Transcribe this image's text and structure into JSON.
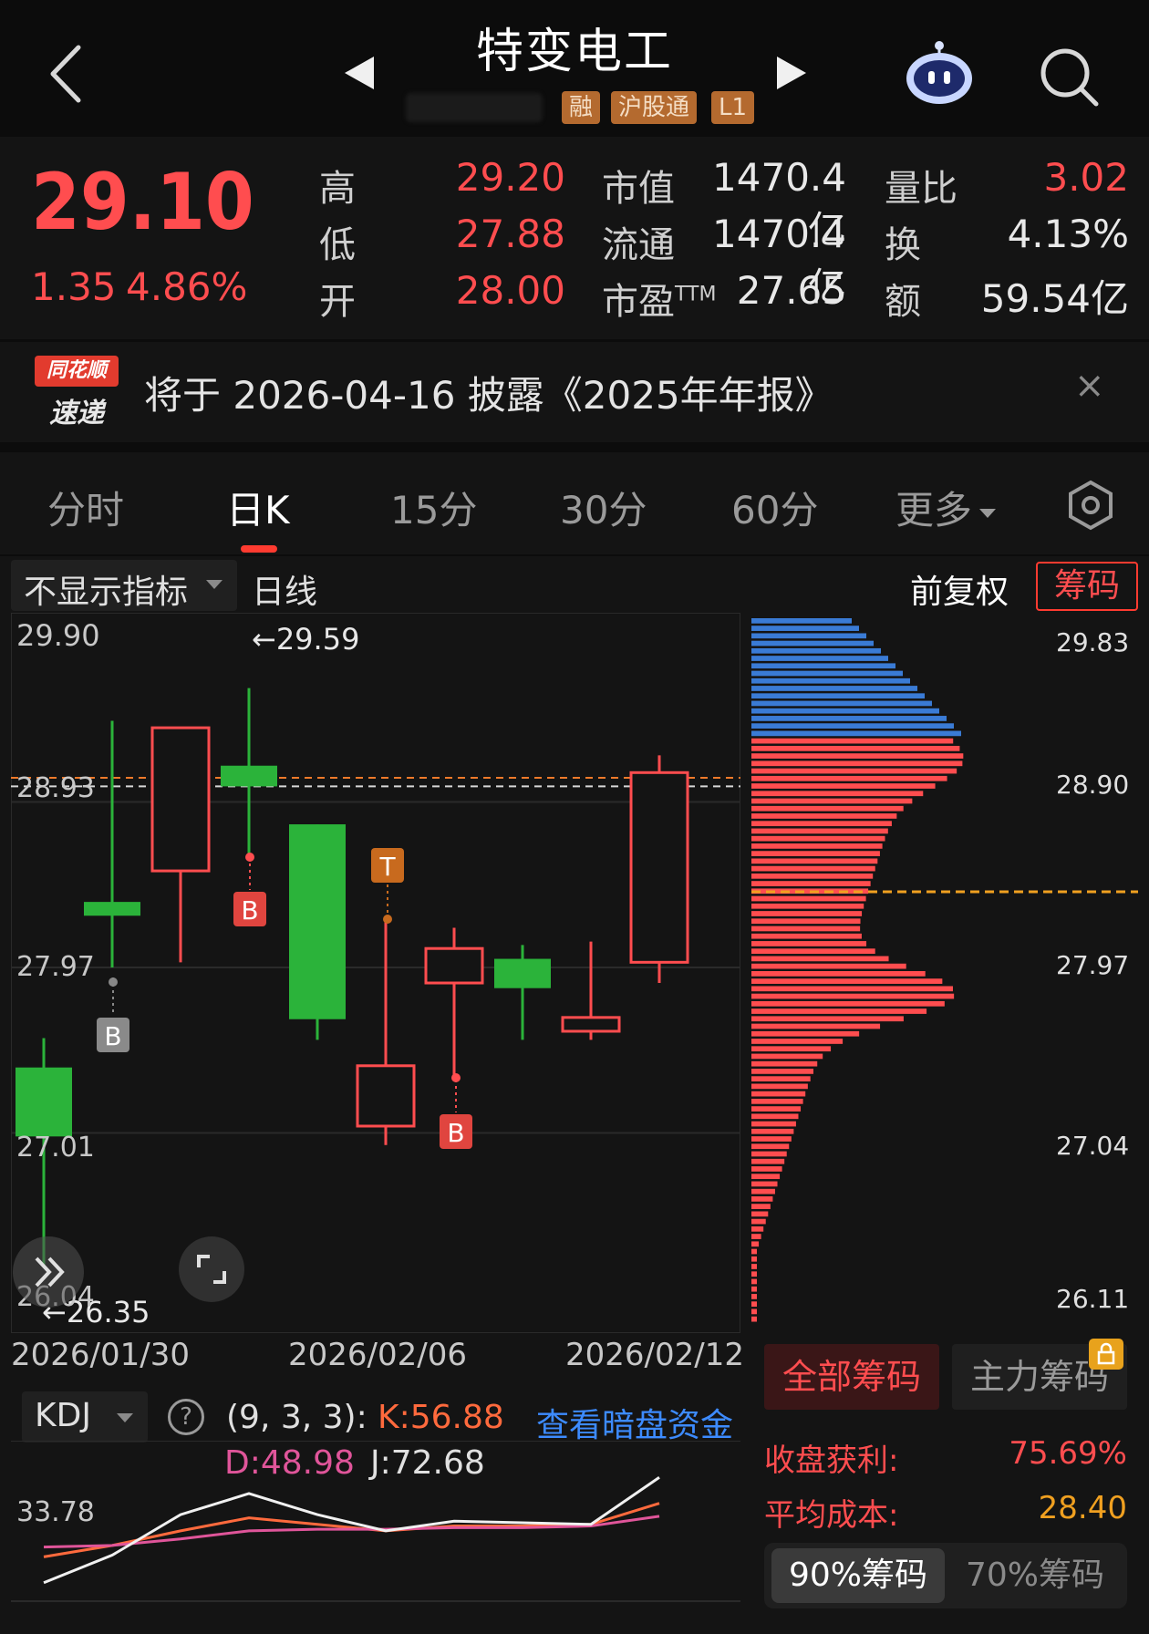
{
  "header": {
    "title": "特变电工",
    "tags": [
      "融",
      "沪股通",
      "L1"
    ]
  },
  "quote": {
    "price": "29.10",
    "change": "1.35",
    "change_pct": "4.86%",
    "high_label": "高",
    "high": "29.20",
    "low_label": "低",
    "low": "27.88",
    "open_label": "开",
    "open": "28.00",
    "mktcap_label": "市值",
    "mktcap": "1470.4亿",
    "float_label": "流通",
    "float": "1470.4亿",
    "pe_label": "市盈",
    "pe_sup": "TTM",
    "pe": "27.65",
    "vol_ratio_label": "量比",
    "vol_ratio": "3.02",
    "turnover_label": "换",
    "turnover": "4.13%",
    "amount_label": "额",
    "amount": "59.54亿"
  },
  "banner": {
    "logo_top": "同花顺",
    "logo_bottom": "速递",
    "text": "将于 2026-04-16 披露《2025年年报》",
    "close": "×"
  },
  "tabs": [
    "分时",
    "日K",
    "15分",
    "30分",
    "60分",
    "更多"
  ],
  "active_tab": 1,
  "chart_toolbar": {
    "indicator": "不显示指标",
    "line": "日线",
    "adjust": "前复权",
    "chips": "筹码"
  },
  "kline": {
    "y_labels": [
      "29.90",
      "28.93",
      "27.97",
      "27.01",
      "26.04"
    ],
    "high_marker": "←29.59",
    "low_marker": "←26.35",
    "x_labels": [
      "2026/01/30",
      "2026/02/06",
      "2026/02/12"
    ],
    "markers": {
      "b": "B",
      "t": "T"
    },
    "candles": [
      {
        "o": 27.39,
        "c": 26.99,
        "h": 27.56,
        "l": 26.23
      },
      {
        "o": 28.35,
        "c": 28.27,
        "h": 29.4,
        "l": 27.97
      },
      {
        "o": 28.53,
        "c": 29.36,
        "h": 29.36,
        "l": 28.0
      },
      {
        "o": 29.14,
        "c": 29.02,
        "h": 29.59,
        "l": 28.6
      },
      {
        "o": 28.8,
        "c": 27.67,
        "h": 28.8,
        "l": 27.55
      },
      {
        "o": 27.05,
        "c": 27.4,
        "h": 28.25,
        "l": 26.94
      },
      {
        "o": 27.88,
        "c": 28.08,
        "h": 28.2,
        "l": 27.32
      },
      {
        "o": 28.02,
        "c": 27.85,
        "h": 28.1,
        "l": 27.55
      },
      {
        "o": 27.6,
        "c": 27.68,
        "h": 28.12,
        "l": 27.55
      },
      {
        "o": 28.0,
        "c": 29.1,
        "h": 29.2,
        "l": 27.88
      }
    ],
    "ref_lines": [
      29.07,
      29.02
    ],
    "color_up": "#ff4d4f",
    "color_down": "#2bb33a"
  },
  "chips": {
    "y_labels": [
      "29.83",
      "28.90",
      "27.97",
      "27.04",
      "26.11"
    ],
    "avg_cost_line": 28.4,
    "tab_all": "全部筹码",
    "tab_main": "主力筹码",
    "profit_label": "收盘获利:",
    "profit": "75.69%",
    "avg_cost_label": "平均成本:",
    "avg_cost": "28.40",
    "pct90": "90%筹码",
    "pct70": "70%筹码",
    "color_profit": "#ff4d4f",
    "color_loss": "#3a7bd5"
  },
  "kdj": {
    "name": "KDJ",
    "help": "?",
    "params": "(9, 3, 3):",
    "k_text": "K:56.88",
    "d_text": "D:48.98",
    "j_text": "J:72.68",
    "link": "查看暗盘资金",
    "y_label": "33.78",
    "k": [
      24,
      31,
      40,
      48,
      44,
      40,
      43,
      43,
      44,
      57
    ],
    "d": [
      30,
      31,
      35,
      40,
      41,
      41,
      42,
      42,
      43,
      49
    ],
    "j": [
      8,
      25,
      50,
      63,
      50,
      40,
      46,
      45,
      44,
      73
    ],
    "color_k": "#ff6a3d",
    "color_d": "#e0559a",
    "color_j": "#f0f0f0"
  }
}
